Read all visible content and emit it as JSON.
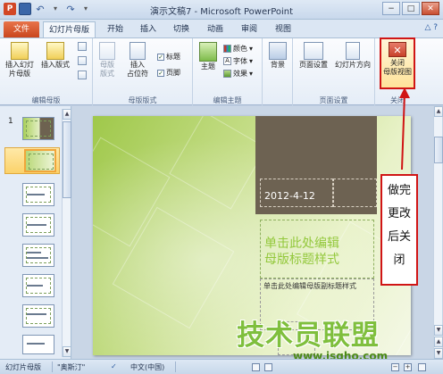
{
  "window": {
    "title": "演示文稿7 - Microsoft PowerPoint",
    "app_icon": "P",
    "controls": [
      "−",
      "□",
      "✕"
    ]
  },
  "quick_access": {
    "icons": [
      "powerpoint-icon",
      "save-icon",
      "undo-icon",
      "redo-icon",
      "customize-icon"
    ]
  },
  "tabs": [
    {
      "label": "文件"
    },
    {
      "label": "幻灯片母版"
    },
    {
      "label": "开始"
    },
    {
      "label": "插入"
    },
    {
      "label": "切换"
    },
    {
      "label": "动画"
    },
    {
      "label": "审阅"
    },
    {
      "label": "视图"
    }
  ],
  "ribbon": {
    "groups": [
      {
        "label": "编辑母版",
        "buttons": [
          "插入幻灯片母版",
          "插入版式"
        ]
      },
      {
        "label": "母版版式",
        "buttons": [
          "母版版式",
          "插入占位符"
        ],
        "checks": [
          "标题",
          "页脚"
        ]
      },
      {
        "label": "编辑主题",
        "buttons": [
          "主题"
        ],
        "small": [
          "颜色",
          "字体",
          "效果"
        ]
      },
      {
        "label": "背景",
        "buttons": [
          "背景"
        ]
      },
      {
        "label": "页面设置",
        "buttons": [
          "页面设置",
          "幻灯片方向"
        ]
      },
      {
        "label": "关闭",
        "buttons": [
          "关闭母版视图"
        ]
      }
    ],
    "insert_master_label": "插入幻灯\n片母版",
    "insert_layout_label": "插入版式",
    "master_layout_label": "母版\n版式",
    "insert_placeholder_label": "插入\n占位符",
    "check_title": "标题",
    "check_footer": "页脚",
    "theme_label": "主题",
    "colors_label": "颜色",
    "fonts_label": "字体",
    "effects_label": "效果",
    "background_label": "背景",
    "page_setup_label": "页面设置",
    "orientation_label": "幻灯片方向",
    "close_label_1": "关闭",
    "close_label_2": "母版视图",
    "group_edit_master": "编辑母版",
    "group_master_layout": "母版版式",
    "group_edit_theme": "编辑主题",
    "group_page_setup": "页面设置",
    "group_close": "关闭"
  },
  "thumbnails": {
    "first_number": "1",
    "count": 8
  },
  "slide": {
    "date": "2012-4-12",
    "title_placeholder_1": "单击此处编辑",
    "title_placeholder_2": "母版标题样式",
    "subtitle_placeholder": "单击此处编辑母版副标题样式"
  },
  "annotation": {
    "lines": [
      "做完",
      "更改",
      "后关",
      "闭"
    ],
    "color": "#d01515"
  },
  "watermark": {
    "text": "技术员联盟",
    "url": "www.jsgho.com"
  },
  "statusbar": {
    "view": "幻灯片母版",
    "theme": "\"奥斯汀\"",
    "language": "中文(中国)"
  },
  "colors": {
    "file_tab": "#c9461e",
    "slide_green": "#9fc84a",
    "slide_brown": "#6d6252",
    "title_green": "#93c83c"
  }
}
